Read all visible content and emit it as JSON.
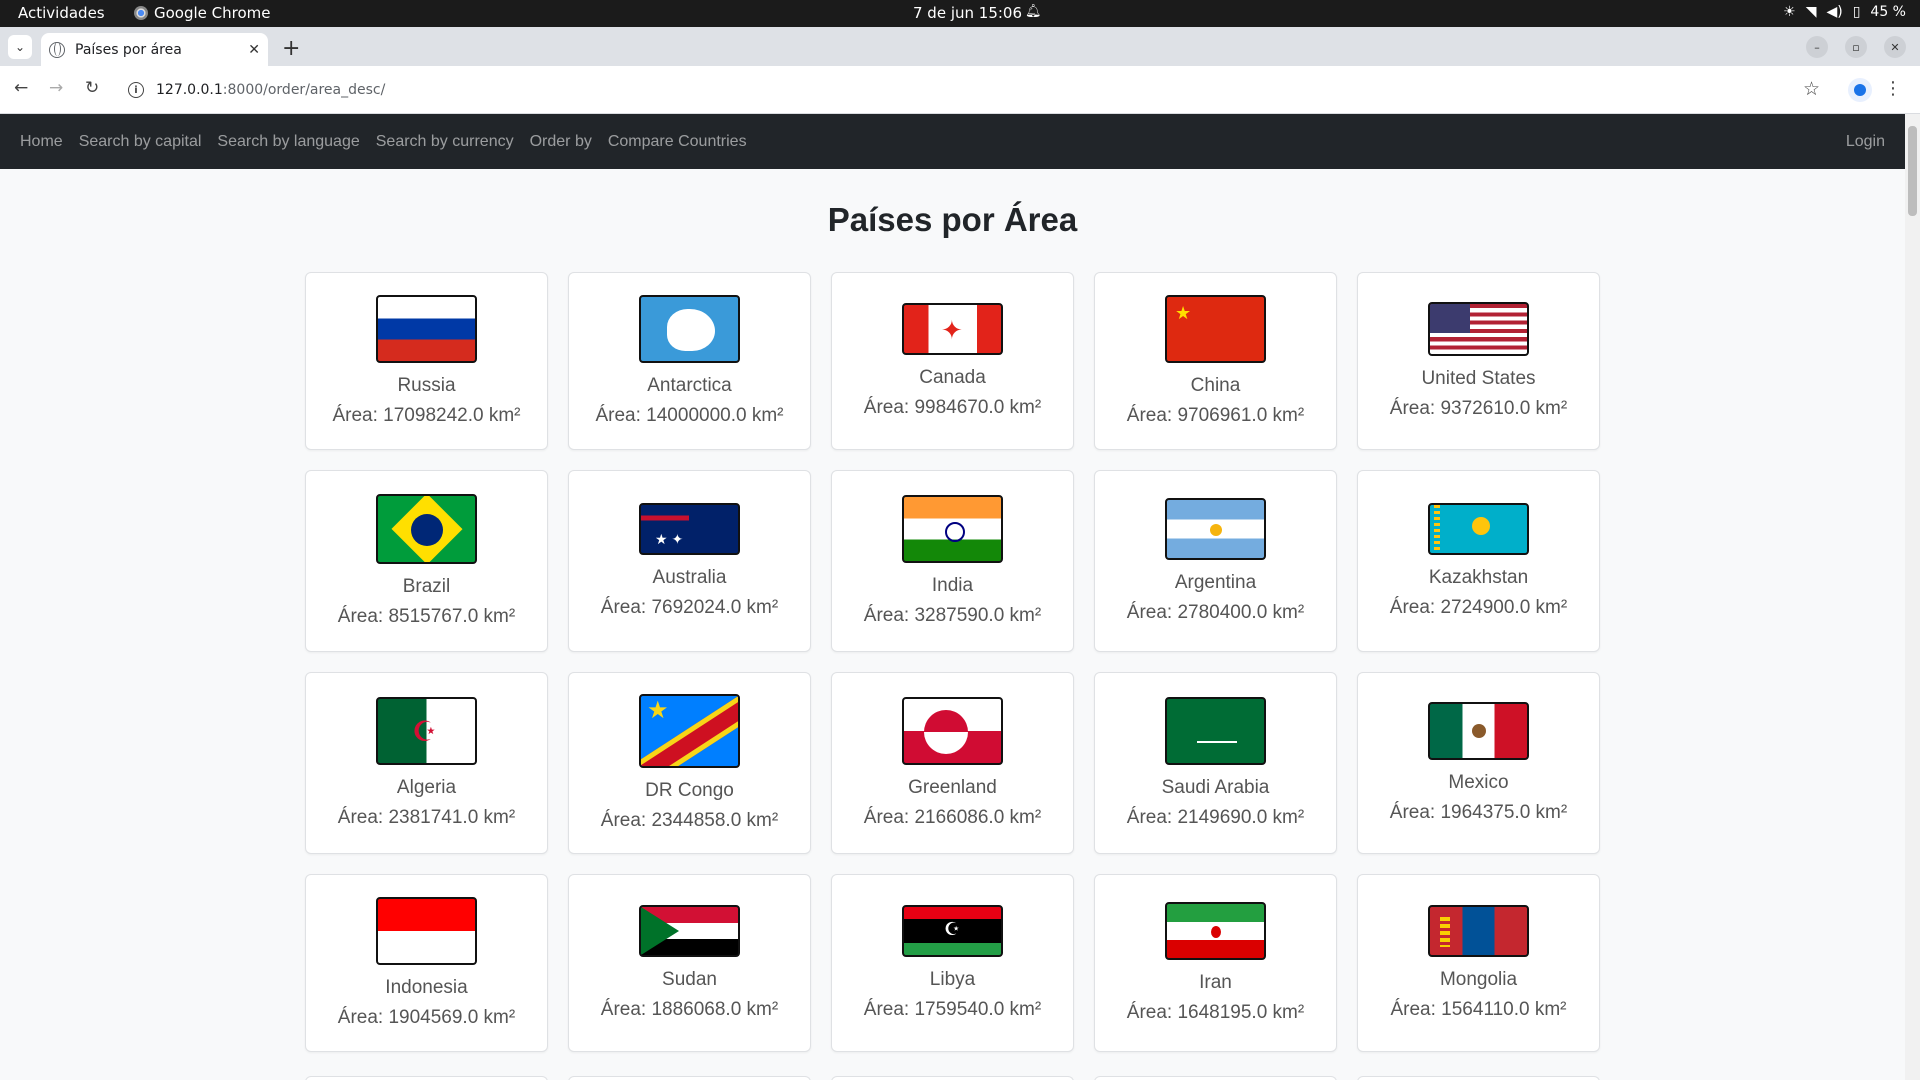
{
  "system": {
    "activities": "Actividades",
    "app_name": "Google Chrome",
    "clock": "7 de jun  15:06",
    "battery": "45 %"
  },
  "browser": {
    "tab_title": "Países por área",
    "url_host": "127.0.0.1",
    "url_rest": ":8000/order/area_desc/"
  },
  "nav": {
    "links": [
      "Home",
      "Search by capital",
      "Search by language",
      "Search by currency",
      "Order by",
      "Compare Countries"
    ],
    "login": "Login"
  },
  "page": {
    "title": "Países por Área"
  },
  "countries": [
    {
      "name": "Russia",
      "area": "Área: 17098242.0 km²",
      "flag": "russia-flag-icon"
    },
    {
      "name": "Antarctica",
      "area": "Área: 14000000.0 km²",
      "flag": "antarctica-flag-icon"
    },
    {
      "name": "Canada",
      "area": "Área: 9984670.0 km²",
      "flag": "canada-flag-icon"
    },
    {
      "name": "China",
      "area": "Área: 9706961.0 km²",
      "flag": "china-flag-icon"
    },
    {
      "name": "United States",
      "area": "Área: 9372610.0 km²",
      "flag": "us-flag-icon"
    },
    {
      "name": "Brazil",
      "area": "Área: 8515767.0 km²",
      "flag": "brazil-flag-icon"
    },
    {
      "name": "Australia",
      "area": "Área: 7692024.0 km²",
      "flag": "australia-flag-icon"
    },
    {
      "name": "India",
      "area": "Área: 3287590.0 km²",
      "flag": "india-flag-icon"
    },
    {
      "name": "Argentina",
      "area": "Área: 2780400.0 km²",
      "flag": "argentina-flag-icon"
    },
    {
      "name": "Kazakhstan",
      "area": "Área: 2724900.0 km²",
      "flag": "kazakhstan-flag-icon"
    },
    {
      "name": "Algeria",
      "area": "Área: 2381741.0 km²",
      "flag": "algeria-flag-icon"
    },
    {
      "name": "DR Congo",
      "area": "Área: 2344858.0 km²",
      "flag": "drc-flag-icon"
    },
    {
      "name": "Greenland",
      "area": "Área: 2166086.0 km²",
      "flag": "greenland-flag-icon"
    },
    {
      "name": "Saudi Arabia",
      "area": "Área: 2149690.0 km²",
      "flag": "saudi-flag-icon"
    },
    {
      "name": "Mexico",
      "area": "Área: 1964375.0 km²",
      "flag": "mexico-flag-icon"
    },
    {
      "name": "Indonesia",
      "area": "Área: 1904569.0 km²",
      "flag": "indonesia-flag-icon"
    },
    {
      "name": "Sudan",
      "area": "Área: 1886068.0 km²",
      "flag": "sudan-flag-icon"
    },
    {
      "name": "Libya",
      "area": "Área: 1759540.0 km²",
      "flag": "libya-flag-icon"
    },
    {
      "name": "Iran",
      "area": "Área: 1648195.0 km²",
      "flag": "iran-flag-icon"
    },
    {
      "name": "Mongolia",
      "area": "Área: 1564110.0 km²",
      "flag": "mongolia-flag-icon"
    }
  ]
}
